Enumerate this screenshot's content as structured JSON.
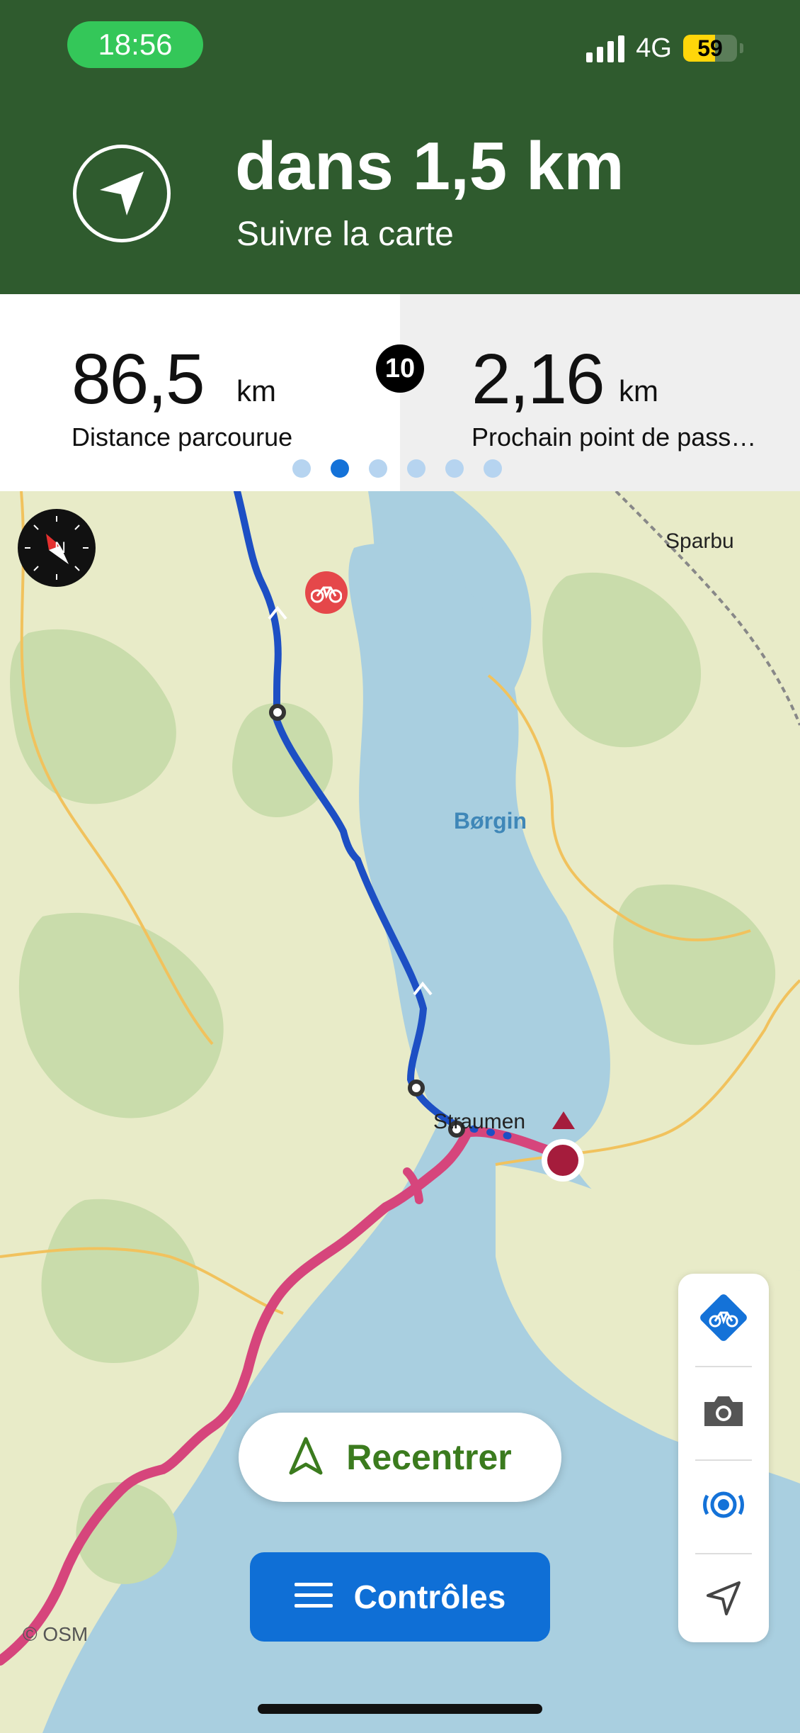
{
  "status_bar": {
    "time": "18:56",
    "network": "4G",
    "battery_percent": 59,
    "battery_text": "59",
    "signal_bars": 4
  },
  "navigation": {
    "distance": "dans 1,5 km",
    "instruction": "Suivre la carte",
    "icon": "navigation-arrow-icon"
  },
  "stats": {
    "left": {
      "value": "86,5",
      "unit": "km",
      "label": "Distance parcourue"
    },
    "waypoint_badge": "10",
    "right": {
      "value": "2,16",
      "unit": "km",
      "label": "Prochain point de pass…"
    },
    "page_dots": {
      "count": 6,
      "active_index": 1
    }
  },
  "map": {
    "labels": {
      "sparbu": "Sparbu",
      "borgin": "Børgin",
      "straumen": "Straumen"
    },
    "attribution": "© OSM",
    "route_color": "#1d4fc4",
    "track_color": "#d6457c",
    "position_color": "#a51c3c"
  },
  "toolbar": {
    "items": [
      "bike-profile-icon",
      "camera-icon",
      "broadcast-icon",
      "location-arrow-icon"
    ]
  },
  "buttons": {
    "recenter": "Recentrer",
    "controls": "Contrôles"
  },
  "colors": {
    "header_bg": "#2f5b2e",
    "accent_blue": "#0f6fd6",
    "accent_green": "#3b7b1e",
    "time_pill": "#34c759"
  }
}
